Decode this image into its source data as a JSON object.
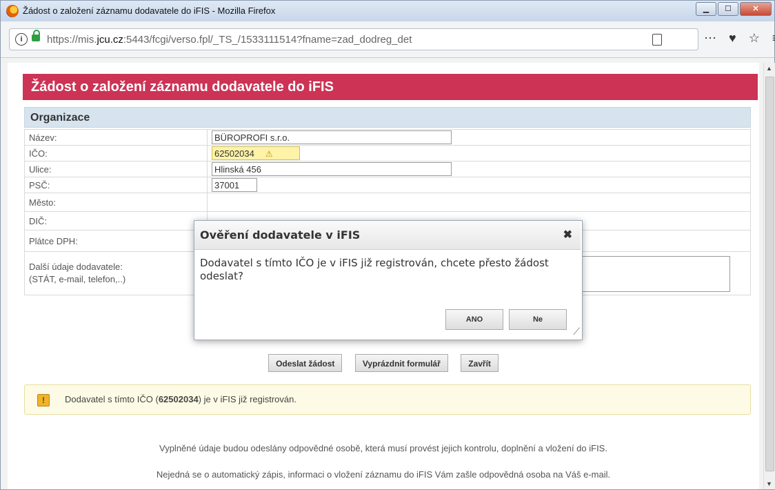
{
  "browser": {
    "window_title": "Žádost o založení záznamu dodavatele do iFIS - Mozilla Firefox",
    "url_prefix": "https://mis.",
    "url_domain": "jcu.cz",
    "url_suffix": ":5443/fcgi/verso.fpl/_TS_/1533111514?fname=zad_dodreg_det",
    "icons": [
      "firefox-logo-icon",
      "info-icon",
      "lock-icon",
      "reader-view-icon",
      "more-icon",
      "pocket-icon",
      "bookmark-star-icon",
      "menu-icon"
    ]
  },
  "page": {
    "header_title": "Žádost o založení záznamu dodavatele do iFIS",
    "section_title": "Organizace",
    "fields": {
      "nazev_label": "Název:",
      "nazev_value": "BÜROPROFI s.r.o.",
      "ico_label": "IČO:",
      "ico_value": "62502034",
      "ulice_label": "Ulice:",
      "ulice_value": "Hlinská 456",
      "psc_label": "PSČ:",
      "psc_value": "37001",
      "mesto_label": "Město:",
      "dic_label": "DIČ:",
      "platce_label": "Plátce DPH:",
      "dalsi_label_1": "Další údaje dodavatele:",
      "dalsi_label_2": "(STÁT, e-mail, telefon,..)"
    },
    "buttons": {
      "send": "Odeslat žádost",
      "clear": "Vyprázdnit formulář",
      "close": "Zavřít"
    },
    "notice": {
      "prefix": "Dodavatel s tímto IČO (",
      "ico": "62502034",
      "suffix": ") je v iFIS již registrován."
    },
    "footer_line1": "Vyplněné údaje budou odeslány odpovědné osobě, která musí provést jejich kontrolu, doplnění a vložení do iFIS.",
    "footer_line2": "Nejedná se o automatický zápis, informaci o vložení záznamu do iFIS Vám zašle odpovědná osoba na Váš e-mail."
  },
  "dialog": {
    "title": "Ověření dodavatele v iFIS",
    "message": "Dodavatel s tímto IČO je v iFIS již registrován, chcete přesto žádost odeslat?",
    "yes_label": "ANO",
    "no_label": "Ne"
  },
  "colors": {
    "header_bg": "#cc3355",
    "section_bg": "#d7e4ee",
    "notice_bg": "#fdfbe6",
    "warn_field_bg": "#fff3a8"
  }
}
